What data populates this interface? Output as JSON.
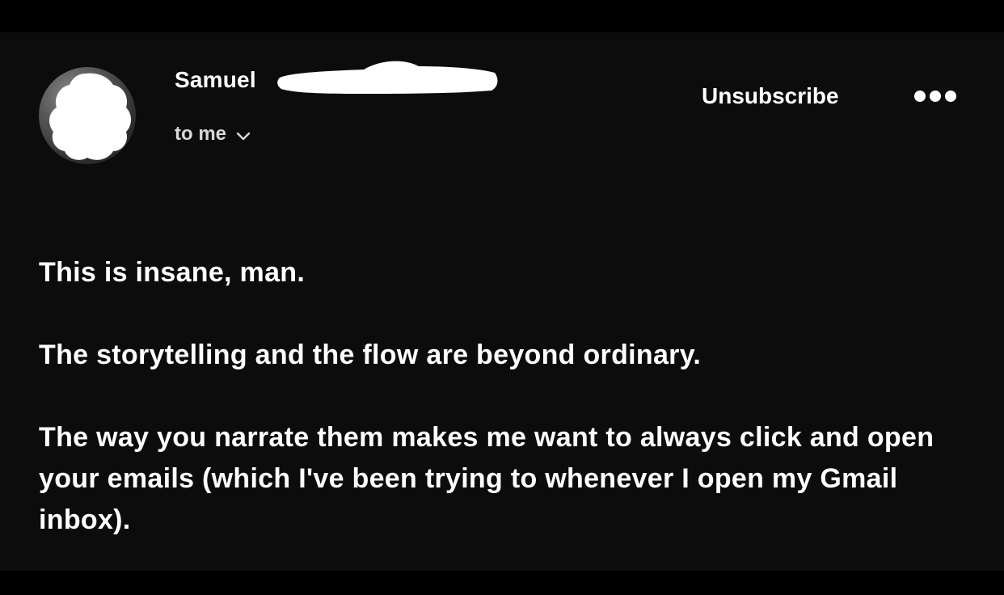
{
  "email": {
    "sender_name": "Samuel",
    "recipient": "to me",
    "unsubscribe_label": "Unsubscribe",
    "paragraphs": [
      "This is insane, man.",
      "The storytelling and the flow are beyond ordinary.",
      "The way you narrate them makes me want to always click and open your emails (which I've been trying to whenever I open my Gmail inbox)."
    ]
  },
  "icons": {
    "more": "more-options-icon",
    "chevron": "chevron-down-icon",
    "avatar": "avatar"
  },
  "colors": {
    "background": "#0c0c0c",
    "outer_border": "#000000",
    "text": "#ffffff",
    "secondary_text": "#d8d8d8",
    "redaction": "#ffffff"
  }
}
